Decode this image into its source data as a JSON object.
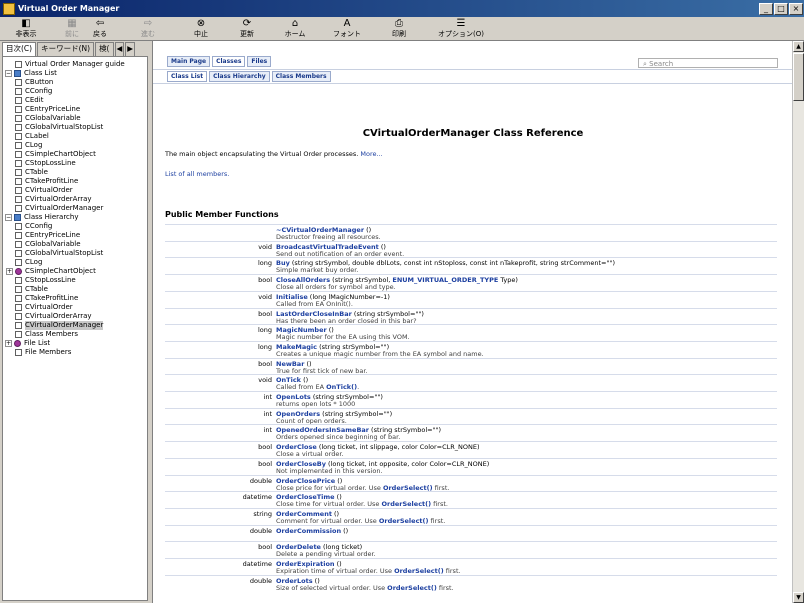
{
  "window": {
    "title": "Virtual Order Manager",
    "buttons": [
      "_",
      "□",
      "×"
    ]
  },
  "toolbar": [
    {
      "label": "非表示",
      "glyph": "◧",
      "enabled": true
    },
    {
      "label": "前に",
      "glyph": "▦",
      "enabled": false
    },
    {
      "label": "戻る",
      "glyph": "⇦",
      "enabled": true
    },
    {
      "label": "進む",
      "glyph": "⇨",
      "enabled": false
    },
    {
      "label": "中止",
      "glyph": "⊗",
      "enabled": true
    },
    {
      "label": "更新",
      "glyph": "⟳",
      "enabled": true
    },
    {
      "label": "ホーム",
      "glyph": "⌂",
      "enabled": true
    },
    {
      "label": "フォント",
      "glyph": "A",
      "enabled": true
    },
    {
      "label": "印刷",
      "glyph": "⎙",
      "enabled": true
    },
    {
      "label": "オプション(O)",
      "glyph": "☰",
      "enabled": true
    }
  ],
  "left_tabs": [
    "目次(C)",
    "キーワード(N)",
    "検(",
    "◀",
    "▶"
  ],
  "tree": [
    {
      "label": "Virtual Order Manager guide",
      "indent": 1,
      "icon": "page"
    },
    {
      "label": "Class List",
      "indent": 0,
      "icon": "folder",
      "expander": "−"
    },
    {
      "label": "CButton",
      "indent": 1,
      "icon": "page"
    },
    {
      "label": "CConfig",
      "indent": 1,
      "icon": "page"
    },
    {
      "label": "CEdit",
      "indent": 1,
      "icon": "page"
    },
    {
      "label": "CEntryPriceLine",
      "indent": 1,
      "icon": "page"
    },
    {
      "label": "CGlobalVariable",
      "indent": 1,
      "icon": "page"
    },
    {
      "label": "CGlobalVirtualStopList",
      "indent": 1,
      "icon": "page"
    },
    {
      "label": "CLabel",
      "indent": 1,
      "icon": "page"
    },
    {
      "label": "CLog",
      "indent": 1,
      "icon": "page"
    },
    {
      "label": "CSimpleChartObject",
      "indent": 1,
      "icon": "page"
    },
    {
      "label": "CStopLossLine",
      "indent": 1,
      "icon": "page"
    },
    {
      "label": "CTable",
      "indent": 1,
      "icon": "page"
    },
    {
      "label": "CTakeProfitLine",
      "indent": 1,
      "icon": "page"
    },
    {
      "label": "CVirtualOrder",
      "indent": 1,
      "icon": "page"
    },
    {
      "label": "CVirtualOrderArray",
      "indent": 1,
      "icon": "page"
    },
    {
      "label": "CVirtualOrderManager",
      "indent": 1,
      "icon": "page"
    },
    {
      "label": "Class Hierarchy",
      "indent": 0,
      "icon": "folder",
      "expander": "−"
    },
    {
      "label": "CConfig",
      "indent": 1,
      "icon": "page"
    },
    {
      "label": "CEntryPriceLine",
      "indent": 1,
      "icon": "page"
    },
    {
      "label": "CGlobalVariable",
      "indent": 1,
      "icon": "page"
    },
    {
      "label": "CGlobalVirtualStopList",
      "indent": 1,
      "icon": "page"
    },
    {
      "label": "CLog",
      "indent": 1,
      "icon": "page"
    },
    {
      "label": "CSimpleChartObject",
      "indent": 1,
      "icon": "mag",
      "expander": "+"
    },
    {
      "label": "CStopLossLine",
      "indent": 1,
      "icon": "page"
    },
    {
      "label": "CTable",
      "indent": 1,
      "icon": "page"
    },
    {
      "label": "CTakeProfitLine",
      "indent": 1,
      "icon": "page"
    },
    {
      "label": "CVirtualOrder",
      "indent": 1,
      "icon": "page"
    },
    {
      "label": "CVirtualOrderArray",
      "indent": 1,
      "icon": "page"
    },
    {
      "label": "CVirtualOrderManager",
      "indent": 1,
      "icon": "page",
      "selected": true
    },
    {
      "label": "Class Members",
      "indent": 1,
      "icon": "page"
    },
    {
      "label": "File List",
      "indent": 0,
      "icon": "mag",
      "expander": "+"
    },
    {
      "label": "File Members",
      "indent": 1,
      "icon": "page"
    }
  ],
  "doc": {
    "tabs1": [
      "Main Page",
      "Classes",
      "Files"
    ],
    "tabs1_current": 1,
    "tabs2": [
      "Class List",
      "Class Hierarchy",
      "Class Members"
    ],
    "search_placeholder": "Search",
    "title": "CVirtualOrderManager Class Reference",
    "intro": "The main object encapsulating the Virtual Order processes.",
    "more": "More...",
    "all_members": "List of all members.",
    "section": "Public Member Functions",
    "members": [
      {
        "type": "",
        "name": "~CVirtualOrderManager",
        "args": " ()",
        "desc": "Destructor freeing all resources."
      },
      {
        "type": "void",
        "name": "BroadcastVirtualTradeEvent",
        "args": " ()",
        "desc": "Send out notification of an order event."
      },
      {
        "type": "long",
        "name": "Buy",
        "args": " (string strSymbol, double dblLots, const int nStoploss, const int nTakeprofit, string strComment=\"\")",
        "desc": "Simple market buy order."
      },
      {
        "type": "bool",
        "name": "CloseAllOrders",
        "args": " (string strSymbol, ",
        "args_link": "ENUM_VIRTUAL_ORDER_TYPE",
        "args_tail": " Type)",
        "desc": "Close all orders for symbol and type."
      },
      {
        "type": "void",
        "name": "Initialise",
        "args": " (long lMagicNumber=-1)",
        "desc": "Called from EA OnInit()."
      },
      {
        "type": "bool",
        "name": "LastOrderCloseInBar",
        "args": " (string strSymbol=\"\")",
        "desc": "Has there been an order closed in this bar?"
      },
      {
        "type": "long",
        "name": "MagicNumber",
        "args": " ()",
        "desc": "Magic number for the EA using this VOM."
      },
      {
        "type": "long",
        "name": "MakeMagic",
        "args": " (string strSymbol=\"\")",
        "desc": "Creates a unique magic number from the EA symbol and name."
      },
      {
        "type": "bool",
        "name": "NewBar",
        "args": " ()",
        "desc": "True for first tick of new bar."
      },
      {
        "type": "void",
        "name": "OnTick",
        "args": " ()",
        "desc": "Called from EA ",
        "desc_link": "OnTick()",
        "desc_tail": "."
      },
      {
        "type": "int",
        "name": "OpenLots",
        "args": " (string strSymbol=\"\")",
        "desc": "returns open lots * 1000"
      },
      {
        "type": "int",
        "name": "OpenOrders",
        "args": " (string strSymbol=\"\")",
        "desc": "Count of open orders."
      },
      {
        "type": "int",
        "name": "OpenedOrdersInSameBar",
        "args": " (string strSymbol=\"\")",
        "desc": "Orders opened since beginning of bar."
      },
      {
        "type": "bool",
        "name": "OrderClose",
        "args": " (long ticket, int slippage, color Color=CLR_NONE)",
        "desc": "Close a virtual order."
      },
      {
        "type": "bool",
        "name": "OrderCloseBy",
        "args": " (long ticket, int opposite, color Color=CLR_NONE)",
        "desc": "Not implemented in this version."
      },
      {
        "type": "double",
        "name": "OrderClosePrice",
        "args": " ()",
        "desc": "Close price for virtual order. Use ",
        "desc_link": "OrderSelect()",
        "desc_tail": " first."
      },
      {
        "type": "datetime",
        "name": "OrderCloseTime",
        "args": " ()",
        "desc": "Close time for virtual order. Use ",
        "desc_link": "OrderSelect()",
        "desc_tail": " first."
      },
      {
        "type": "string",
        "name": "OrderComment",
        "args": " ()",
        "desc": "Comment for virtual order. Use ",
        "desc_link": "OrderSelect()",
        "desc_tail": " first."
      },
      {
        "type": "double",
        "name": "OrderCommission",
        "args": " ()",
        "desc": ""
      },
      {
        "type": "bool",
        "name": "OrderDelete",
        "args": " (long ticket)",
        "desc": "Delete a pending virtual order."
      },
      {
        "type": "datetime",
        "name": "OrderExpiration",
        "args": " ()",
        "desc": "Expiration time of virtual order. Use ",
        "desc_link": "OrderSelect()",
        "desc_tail": " first."
      },
      {
        "type": "double",
        "name": "OrderLots",
        "args": " ()",
        "desc": "Size of selected virtual order. Use ",
        "desc_link": "OrderSelect()",
        "desc_tail": " first."
      }
    ]
  }
}
